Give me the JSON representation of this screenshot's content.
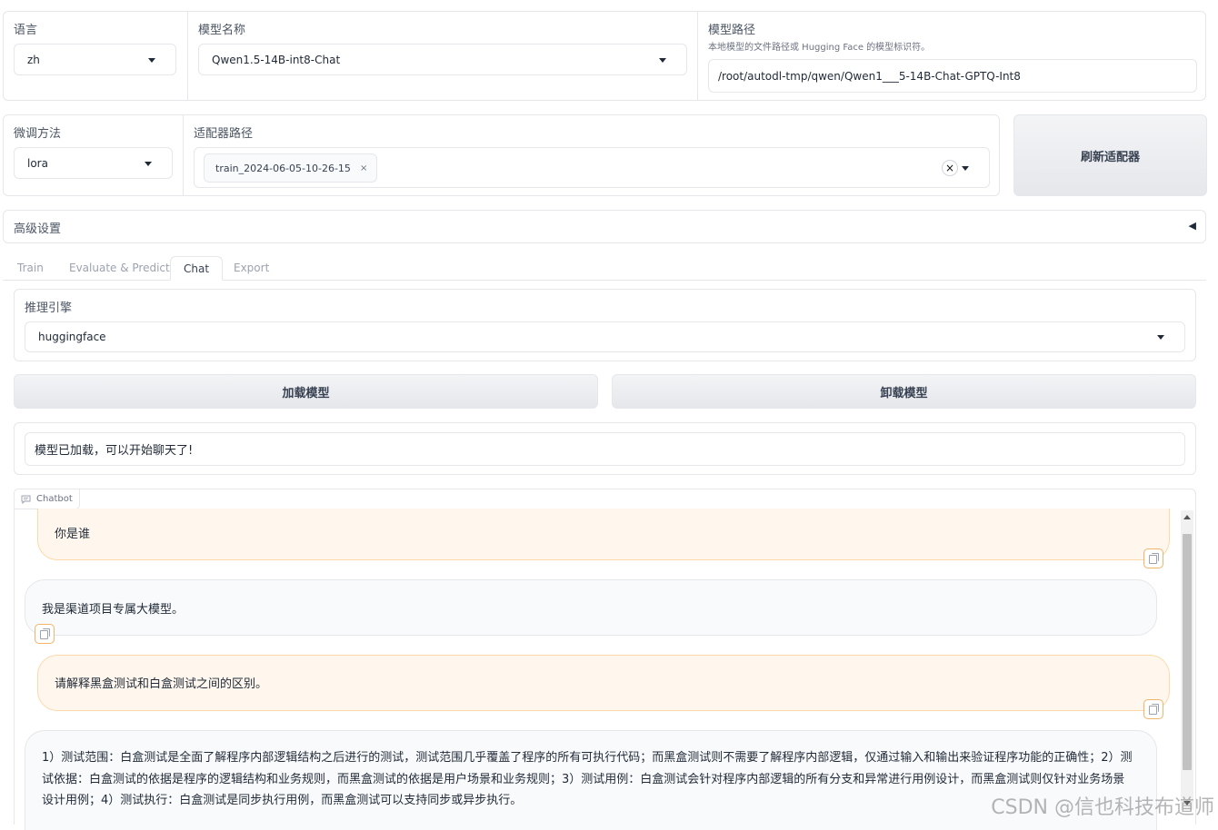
{
  "top_row": {
    "language": {
      "label": "语言",
      "value": "zh"
    },
    "model_name": {
      "label": "模型名称",
      "value": "Qwen1.5-14B-int8-Chat"
    },
    "model_path": {
      "label": "模型路径",
      "info": "本地模型的文件路径或 Hugging Face 的模型标识符。",
      "value": "/root/autodl-tmp/qwen/Qwen1___5-14B-Chat-GPTQ-Int8"
    }
  },
  "second_row": {
    "finetune": {
      "label": "微调方法",
      "value": "lora"
    },
    "adapter": {
      "label": "适配器路径",
      "chip": "train_2024-06-05-10-26-15",
      "chip_remove": "×",
      "clear": "×"
    },
    "refresh_button": "刷新适配器"
  },
  "advanced": {
    "label": "高级设置",
    "toggle": "◀"
  },
  "tabs": [
    {
      "label": "Train"
    },
    {
      "label": "Evaluate & Predict"
    },
    {
      "label": "Chat"
    },
    {
      "label": "Export"
    }
  ],
  "active_tab": "Chat",
  "chat": {
    "engine": {
      "label": "推理引擎",
      "value": "huggingface"
    },
    "load_button": "加载模型",
    "unload_button": "卸载模型",
    "status": "模型已加载，可以开始聊天了!",
    "chatbot_label": "Chatbot",
    "messages": [
      {
        "role": "user",
        "text": "你是谁"
      },
      {
        "role": "assistant",
        "text": "我是渠道项目专属大模型。"
      },
      {
        "role": "user",
        "text": "请解释黑盒测试和白盒测试之间的区别。"
      },
      {
        "role": "assistant",
        "text": "1）测试范围：白盒测试是全面了解程序内部逻辑结构之后进行的测试，测试范围几乎覆盖了程序的所有可执行代码；而黑盒测试则不需要了解程序内部逻辑，仅通过输入和输出来验证程序功能的正确性；2）测试依据：白盒测试的依据是程序的逻辑结构和业务规则，而黑盒测试的依据是用户场景和业务规则；3）测试用例：白盒测试会针对程序内部逻辑的所有分支和异常进行用例设计，而黑盒测试则仅针对业务场景设计用例；4）测试执行：白盒测试是同步执行用例，而黑盒测试可以支持同步或异步执行。"
      }
    ]
  },
  "watermark": "CSDN @信也科技布道师"
}
